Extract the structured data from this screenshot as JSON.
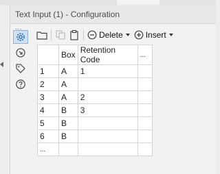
{
  "window": {
    "title": "Text Input (1) - Configuration"
  },
  "sidebar": {
    "dots": "...",
    "icons": [
      "settings-icon",
      "output-anchor-icon",
      "tag-icon",
      "help-icon"
    ]
  },
  "toolbar": {
    "delete_label": "Delete",
    "insert_label": "Insert"
  },
  "table": {
    "headers": [
      "",
      "Box",
      "Retention Code",
      "..."
    ],
    "rows": [
      {
        "num": "1",
        "box": "A",
        "code": "1"
      },
      {
        "num": "2",
        "box": "A",
        "code": ""
      },
      {
        "num": "3",
        "box": "A",
        "code": "2"
      },
      {
        "num": "4",
        "box": "B",
        "code": "3"
      },
      {
        "num": "5",
        "box": "B",
        "code": ""
      },
      {
        "num": "6",
        "box": "B",
        "code": ""
      }
    ],
    "new_row_marker": "..."
  },
  "colors": {
    "panel_bg": "#f2f2f2",
    "selected_icon_bg": "#cfe0f2",
    "icon_blue": "#2b6cb0"
  }
}
